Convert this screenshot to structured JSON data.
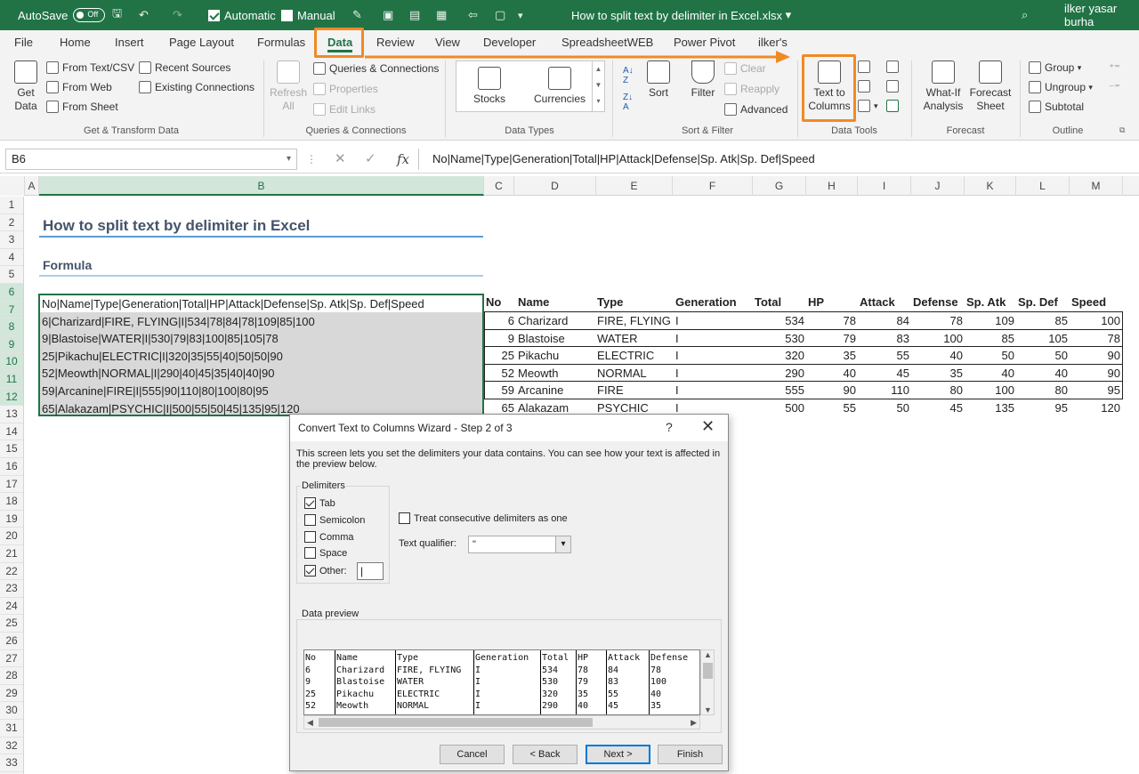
{
  "titlebar": {
    "autosave_label": "AutoSave",
    "autosave_state": "Off",
    "automatic_label": "Automatic",
    "manual_label": "Manual",
    "file_name": "How to split text by delimiter in Excel.xlsx",
    "user": "ilker yasar burha"
  },
  "tabs": [
    "File",
    "Home",
    "Insert",
    "Page Layout",
    "Formulas",
    "Data",
    "Review",
    "View",
    "Developer",
    "SpreadsheetWEB",
    "Power Pivot",
    "ilker's"
  ],
  "ribbon": {
    "get_data": "Get Data",
    "from_text_csv": "From Text/CSV",
    "from_web": "From Web",
    "from_sheet": "From Sheet",
    "recent_sources": "Recent Sources",
    "existing_connections": "Existing Connections",
    "refresh_all": "Refresh All",
    "queries_connections": "Queries & Connections",
    "properties": "Properties",
    "edit_links": "Edit Links",
    "stocks": "Stocks",
    "currencies": "Currencies",
    "sort": "Sort",
    "filter": "Filter",
    "clear": "Clear",
    "reapply": "Reapply",
    "advanced": "Advanced",
    "text_to_columns": "Text to Columns",
    "what_if": "What-If Analysis",
    "forecast_sheet": "Forecast Sheet",
    "group": "Group",
    "ungroup": "Ungroup",
    "subtotal": "Subtotal",
    "groups": {
      "get_transform": "Get & Transform Data",
      "queries": "Queries & Connections",
      "data_types": "Data Types",
      "sort_filter": "Sort & Filter",
      "data_tools": "Data Tools",
      "forecast": "Forecast",
      "outline": "Outline"
    }
  },
  "formula_bar": {
    "name_box": "B6",
    "formula": "No|Name|Type|Generation|Total|HP|Attack|Defense|Sp. Atk|Sp. Def|Speed"
  },
  "columns": [
    "A",
    "B",
    "C",
    "D",
    "E",
    "F",
    "G",
    "H",
    "I",
    "J",
    "K",
    "L",
    "M"
  ],
  "rows": [
    "1",
    "2",
    "3",
    "4",
    "5",
    "6",
    "7",
    "8",
    "9",
    "10",
    "11",
    "12",
    "13",
    "14",
    "15",
    "16",
    "17",
    "18",
    "19",
    "20",
    "21",
    "22",
    "23",
    "24",
    "25",
    "26",
    "27",
    "28",
    "29",
    "30",
    "31",
    "32",
    "33"
  ],
  "sheet": {
    "title": "How to split text by delimiter in Excel",
    "formula_label": "Formula",
    "raw_rows": [
      "No|Name|Type|Generation|Total|HP|Attack|Defense|Sp. Atk|Sp. Def|Speed",
      "6|Charizard|FIRE, FLYING|I|534|78|84|78|109|85|100",
      "9|Blastoise|WATER|I|530|79|83|100|85|105|78",
      "25|Pikachu|ELECTRIC|I|320|35|55|40|50|50|90",
      "52|Meowth|NORMAL|I|290|40|45|35|40|40|90",
      "59|Arcanine|FIRE|I|555|90|110|80|100|80|95",
      "65|Alakazam|PSYCHIC|I|500|55|50|45|135|95|120"
    ],
    "table_headers": [
      "No",
      "Name",
      "Type",
      "Generation",
      "Total",
      "HP",
      "Attack",
      "Defense",
      "Sp. Atk",
      "Sp. Def",
      "Speed"
    ],
    "table_rows": [
      [
        "6",
        "Charizard",
        "FIRE, FLYING",
        "I",
        "534",
        "78",
        "84",
        "78",
        "109",
        "85",
        "100"
      ],
      [
        "9",
        "Blastoise",
        "WATER",
        "I",
        "530",
        "79",
        "83",
        "100",
        "85",
        "105",
        "78"
      ],
      [
        "25",
        "Pikachu",
        "ELECTRIC",
        "I",
        "320",
        "35",
        "55",
        "40",
        "50",
        "50",
        "90"
      ],
      [
        "52",
        "Meowth",
        "NORMAL",
        "I",
        "290",
        "40",
        "45",
        "35",
        "40",
        "40",
        "90"
      ],
      [
        "59",
        "Arcanine",
        "FIRE",
        "I",
        "555",
        "90",
        "110",
        "80",
        "100",
        "80",
        "95"
      ],
      [
        "65",
        "Alakazam",
        "PSYCHIC",
        "I",
        "500",
        "55",
        "50",
        "45",
        "135",
        "95",
        "120"
      ]
    ]
  },
  "dialog": {
    "title": "Convert Text to Columns Wizard - Step 2 of 3",
    "help": "?",
    "close": "✕",
    "description": "This screen lets you set the delimiters your data contains.  You can see how your text is affected in the preview below.",
    "delimiters_label": "Delimiters",
    "tab": "Tab",
    "semicolon": "Semicolon",
    "comma": "Comma",
    "space": "Space",
    "other": "Other:",
    "other_value": "|",
    "checked": {
      "tab": true,
      "semicolon": false,
      "comma": false,
      "space": false,
      "other": true,
      "consecutive": false
    },
    "consecutive": "Treat consecutive delimiters as one",
    "qualifier_label": "Text qualifier:",
    "qualifier_value": "\"",
    "preview_label": "Data preview",
    "preview_columns": [
      [
        "No",
        "6",
        "9",
        "25",
        "52"
      ],
      [
        "Name",
        "Charizard",
        "Blastoise",
        "Pikachu",
        "Meowth"
      ],
      [
        "Type",
        "FIRE, FLYING",
        "WATER",
        "ELECTRIC",
        "NORMAL"
      ],
      [
        "Generation",
        "I",
        "I",
        "I",
        "I"
      ],
      [
        "Total",
        "534",
        "530",
        "320",
        "290"
      ],
      [
        "HP",
        "78",
        "79",
        "35",
        "40"
      ],
      [
        "Attack",
        "84",
        "83",
        "55",
        "45"
      ],
      [
        "Defense",
        "78",
        "100",
        "40",
        "35"
      ]
    ],
    "buttons": {
      "cancel": "Cancel",
      "back": "< Back",
      "next": "Next >",
      "finish": "Finish"
    }
  },
  "colors": {
    "excel_green": "#217346",
    "highlight_orange": "#f08a24",
    "title_text": "#44546a"
  }
}
